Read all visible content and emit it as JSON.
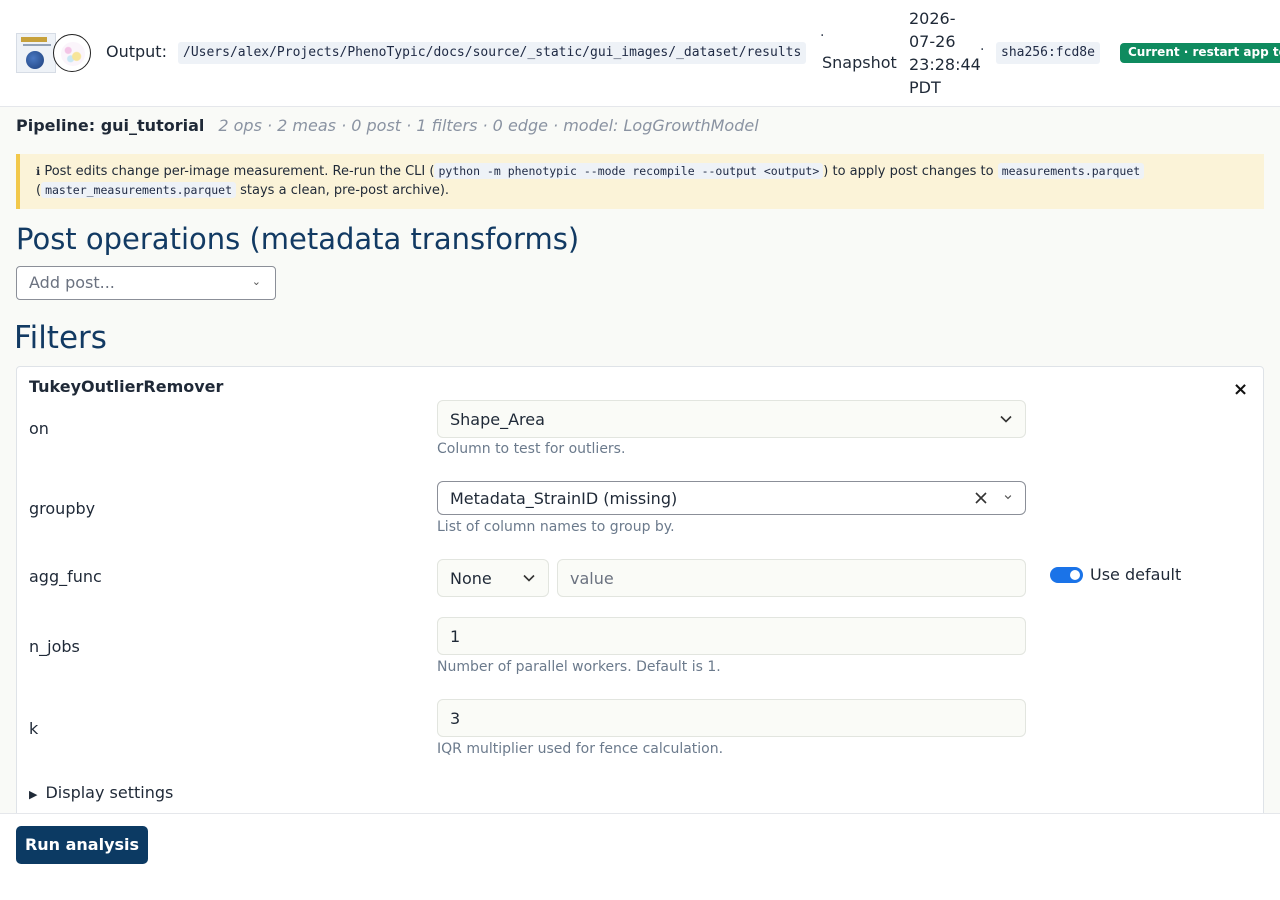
{
  "header": {
    "output_label": "Output:",
    "output_path": "/Users/alex/Projects/PhenoTypic/docs/source/_static/gui_images/_dataset/results",
    "separator": "·",
    "snapshot_label": "Snapshot",
    "timestamp": "2026-07-26 23:28:44 PDT",
    "hash": "sha256:fcd8e",
    "status_badge": "Current · restart app to refresh"
  },
  "pipeline": {
    "label": "Pipeline: gui_tutorial",
    "summary": "2 ops · 2 meas · 0 post · 1 filters · 0 edge · model: LogGrowthModel"
  },
  "info": {
    "icon": "ℹ",
    "text1": "Post edits change per-image measurement. Re-run the CLI (",
    "cmd": "python -m phenotypic --mode recompile --output <output>",
    "text2": ") to apply post changes to",
    "file1": "measurements.parquet",
    "text3": "(",
    "file2": "master_measurements.parquet",
    "text4": "stays a clean, pre-post archive)."
  },
  "post": {
    "heading": "Post operations (metadata transforms)",
    "add_placeholder": "Add post..."
  },
  "filters": {
    "heading": "Filters",
    "card": {
      "title": "TukeyOutlierRemover",
      "close": "×",
      "params": {
        "on": {
          "label": "on",
          "value": "Shape_Area",
          "help": "Column to test for outliers."
        },
        "groupby": {
          "label": "groupby",
          "value": "Metadata_StrainID (missing)",
          "help": "List of column names to group by."
        },
        "agg_func": {
          "label": "agg_func",
          "select": "None",
          "value_placeholder": "value",
          "toggle_label": "Use default",
          "use_default": true
        },
        "n_jobs": {
          "label": "n_jobs",
          "value": "1",
          "help": "Number of parallel workers. Default is 1."
        },
        "k": {
          "label": "k",
          "value": "3",
          "help": "IQR multiplier used for fence calculation."
        }
      },
      "display_settings": "Display settings"
    }
  },
  "footer": {
    "run_label": "Run analysis"
  },
  "colors": {
    "accent": "#0c3a63",
    "badge": "#0f8b5f",
    "toggle": "#1a73e8",
    "info_bg": "#fbf3d8",
    "info_border": "#f2c84b"
  }
}
